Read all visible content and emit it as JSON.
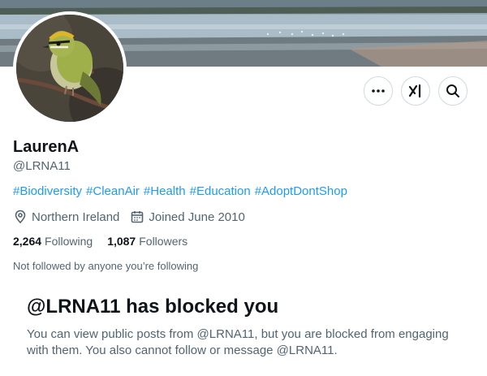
{
  "profile": {
    "display_name": "LaurenA",
    "handle": "@LRNA11",
    "hashtags": [
      "#Biodiversity",
      "#CleanAir",
      "#Health",
      "#Education",
      "#AdoptDontShop"
    ],
    "location": "Northern Ireland",
    "joined": "Joined June 2010",
    "following_count": "2,264",
    "following_label": "Following",
    "followers_count": "1,087",
    "followers_label": "Followers",
    "followed_by_note": "Not followed by anyone you’re following"
  },
  "actions": {
    "more_icon": "more-horizontal-icon",
    "grok_icon": "grok-icon",
    "search_icon": "search-icon"
  },
  "blocked": {
    "title": "@LRNA11 has blocked you",
    "message": "You can view public posts from @LRNA11, but you are blocked from engaging with them. You also cannot follow or message @LRNA11."
  },
  "colors": {
    "link": "#1d9bf0",
    "secondary_text": "#536471",
    "primary_text": "#0f1419",
    "border": "#cfd9de"
  }
}
